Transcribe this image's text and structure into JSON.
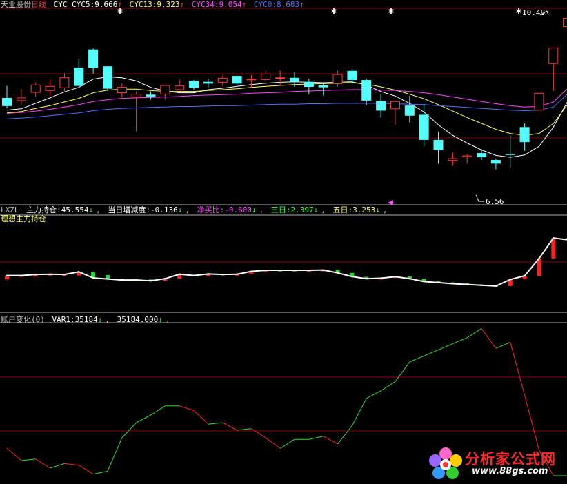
{
  "colors": {
    "up": "#ff3b3b",
    "down": "#54fcfc",
    "grid": "#8a0000",
    "text": "#c0c0c0",
    "white": "#ffffff",
    "yellow": "#ffff55",
    "magenta": "#ff44ff",
    "blue": "#4f6fff",
    "green": "#33ff33"
  },
  "panel1": {
    "stock": "天业股份",
    "period": "日线",
    "indicator": "CYC",
    "cyc5_label": "CYC5:",
    "cyc5_value": "9.666",
    "cyc13_label": "CYC13:",
    "cyc13_value": "9.323",
    "cyc34_label": "CYC34:",
    "cyc34_value": "9.054",
    "cyc0_label": "CYC0:",
    "cyc0_value": "8.683",
    "high_label": "10.48",
    "low_label": "6.56"
  },
  "panel2": {
    "name": "LXZL",
    "main_label": "主力持仓:",
    "main_value": "45.554",
    "daily_label": "当日增减度:",
    "daily_value": "-0.136",
    "net_label": "净买比:",
    "net_value": "-0.600",
    "three_label": "三日:",
    "three_value": "2.397",
    "five_label": "五日:",
    "five_value": "3.253",
    "subtitle": "理想主力持仓"
  },
  "panel3": {
    "name": "账户变化(0)",
    "var_label": "VAR1:",
    "var_value": "35184",
    "var_value2": "35184.000"
  },
  "logo": {
    "text": "分析家公式网",
    "url": "www.88gs.com"
  },
  "chart_data": [
    {
      "type": "candlestick",
      "panel": "price",
      "ylim": [
        6.4,
        10.7
      ],
      "ohlc": [
        [
          8.74,
          9.0,
          8.51,
          8.56
        ],
        [
          8.68,
          8.93,
          8.59,
          8.74
        ],
        [
          8.86,
          9.08,
          8.76,
          9.02
        ],
        [
          8.9,
          9.14,
          8.79,
          8.99
        ],
        [
          8.96,
          9.28,
          8.86,
          9.18
        ],
        [
          9.4,
          9.6,
          9.0,
          9.0
        ],
        [
          9.8,
          9.82,
          9.27,
          9.4
        ],
        [
          9.43,
          9.43,
          8.89,
          8.94
        ],
        [
          8.85,
          9.05,
          8.75,
          8.97
        ],
        [
          8.76,
          8.88,
          8.0,
          8.82
        ],
        [
          8.81,
          8.88,
          8.7,
          8.77
        ],
        [
          8.82,
          8.98,
          8.7,
          9.01
        ],
        [
          8.92,
          9.14,
          8.9,
          9.0
        ],
        [
          9.11,
          9.13,
          8.92,
          8.96
        ],
        [
          9.09,
          9.16,
          8.97,
          9.05
        ],
        [
          9.08,
          9.23,
          9.0,
          9.17
        ],
        [
          9.22,
          9.23,
          9.0,
          9.05
        ],
        [
          9.14,
          9.24,
          8.95,
          9.15
        ],
        [
          9.14,
          9.35,
          9.05,
          9.26
        ],
        [
          9.18,
          9.34,
          9.0,
          9.18
        ],
        [
          9.18,
          9.3,
          8.98,
          9.09
        ],
        [
          9.09,
          9.16,
          8.82,
          8.98
        ],
        [
          9.01,
          9.05,
          8.79,
          8.97
        ],
        [
          9.05,
          9.34,
          8.99,
          9.25
        ],
        [
          9.33,
          9.38,
          9.05,
          9.13
        ],
        [
          9.13,
          9.16,
          8.58,
          8.68
        ],
        [
          8.67,
          8.83,
          8.31,
          8.46
        ],
        [
          8.5,
          8.66,
          8.15,
          8.66
        ],
        [
          8.57,
          8.78,
          8.2,
          8.35
        ],
        [
          8.37,
          8.6,
          7.68,
          7.82
        ],
        [
          7.82,
          8.0,
          7.3,
          7.6
        ],
        [
          7.37,
          7.54,
          7.25,
          7.41
        ],
        [
          7.45,
          7.5,
          7.3,
          7.47
        ],
        [
          7.53,
          7.62,
          7.38,
          7.44
        ],
        [
          7.38,
          7.4,
          7.18,
          7.3
        ],
        [
          7.51,
          7.92,
          7.22,
          7.49
        ],
        [
          8.1,
          8.18,
          7.58,
          7.77
        ],
        [
          8.47,
          8.47,
          8.02,
          8.84
        ],
        [
          9.49,
          9.83,
          8.89,
          9.83
        ],
        [
          10.3,
          10.35,
          9.9,
          10.48
        ]
      ],
      "series": [
        {
          "name": "CYC5",
          "values": [
            8.47,
            8.5,
            8.62,
            8.74,
            8.87,
            8.97,
            9.15,
            9.2,
            9.18,
            9.11,
            8.97,
            8.89,
            8.85,
            8.85,
            8.92,
            8.95,
            8.99,
            9.03,
            9.06,
            9.08,
            9.09,
            9.08,
            9.07,
            9.08,
            9.09,
            9.02,
            8.88,
            8.78,
            8.62,
            8.43,
            8.15,
            7.92,
            7.75,
            7.6,
            7.48,
            7.44,
            7.49,
            7.68,
            8.1,
            8.67
          ]
        },
        {
          "name": "CYC13",
          "values": [
            8.41,
            8.44,
            8.51,
            8.57,
            8.65,
            8.73,
            8.85,
            8.91,
            8.93,
            8.93,
            8.9,
            8.88,
            8.88,
            8.88,
            8.9,
            8.92,
            8.94,
            8.97,
            8.99,
            9.01,
            9.03,
            9.04,
            9.05,
            9.06,
            9.07,
            9.04,
            8.98,
            8.91,
            8.82,
            8.72,
            8.59,
            8.45,
            8.31,
            8.18,
            8.05,
            7.96,
            7.92,
            7.96,
            8.18,
            8.6
          ]
        },
        {
          "name": "CYC34",
          "values": [
            8.4,
            8.42,
            8.45,
            8.49,
            8.54,
            8.59,
            8.66,
            8.7,
            8.73,
            8.74,
            8.75,
            8.76,
            8.77,
            8.79,
            8.8,
            8.81,
            8.82,
            8.84,
            8.85,
            8.86,
            8.88,
            8.89,
            8.9,
            8.91,
            8.92,
            8.92,
            8.91,
            8.9,
            8.88,
            8.85,
            8.81,
            8.76,
            8.71,
            8.66,
            8.61,
            8.57,
            8.54,
            8.55,
            8.65,
            8.95
          ]
        },
        {
          "name": "CYC0",
          "values": [
            8.28,
            8.3,
            8.32,
            8.35,
            8.38,
            8.41,
            8.46,
            8.49,
            8.51,
            8.52,
            8.53,
            8.54,
            8.55,
            8.55,
            8.56,
            8.57,
            8.57,
            8.58,
            8.59,
            8.6,
            8.6,
            8.61,
            8.61,
            8.62,
            8.62,
            8.62,
            8.62,
            8.61,
            8.6,
            8.59,
            8.57,
            8.55,
            8.53,
            8.51,
            8.49,
            8.47,
            8.46,
            8.47,
            8.54,
            8.83
          ]
        }
      ]
    },
    {
      "type": "line",
      "panel": "lxzl",
      "ylim": [
        43.6,
        47.3
      ],
      "series": [
        {
          "name": "主力持仓",
          "values": [
            45.0,
            45.0,
            45.04,
            45.05,
            45.04,
            45.14,
            44.91,
            44.87,
            44.83,
            44.83,
            44.8,
            44.88,
            45.05,
            45.0,
            45.06,
            45.04,
            45.05,
            45.16,
            45.2,
            45.2,
            45.2,
            45.2,
            45.21,
            45.1,
            44.96,
            44.88,
            44.9,
            44.96,
            44.88,
            44.77,
            44.73,
            44.69,
            44.66,
            44.63,
            44.6,
            44.85,
            44.99,
            45.65,
            46.43,
            46.36
          ]
        }
      ],
      "bar_values": [
        0.15,
        0.05,
        0.08,
        0.03,
        0.02,
        0.14,
        -0.22,
        -0.15,
        -0.04,
        -0.01,
        -0.05,
        0.08,
        0.17,
        -0.03,
        0.08,
        -0.02,
        0.01,
        0.1,
        0.06,
        -0.01,
        -0.01,
        0.01,
        0.02,
        -0.12,
        -0.14,
        -0.07,
        0.04,
        0.05,
        -0.09,
        -0.11,
        -0.05,
        -0.05,
        -0.04,
        -0.03,
        -0.03,
        0.25,
        0.13,
        0.66,
        0.78,
        -0.07
      ]
    },
    {
      "type": "line",
      "panel": "account",
      "ylim": [
        0,
        100
      ],
      "series": [
        {
          "name": "VAR1",
          "values": [
            18,
            10,
            11,
            5,
            8,
            7,
            1,
            3,
            25,
            35,
            40,
            46,
            46,
            43,
            34,
            35,
            30,
            31,
            25,
            18,
            24,
            24,
            26,
            21,
            33,
            51,
            56,
            62,
            75,
            79,
            83,
            87,
            91,
            97,
            84,
            88,
            53,
            17,
            0,
            0
          ]
        }
      ]
    }
  ]
}
